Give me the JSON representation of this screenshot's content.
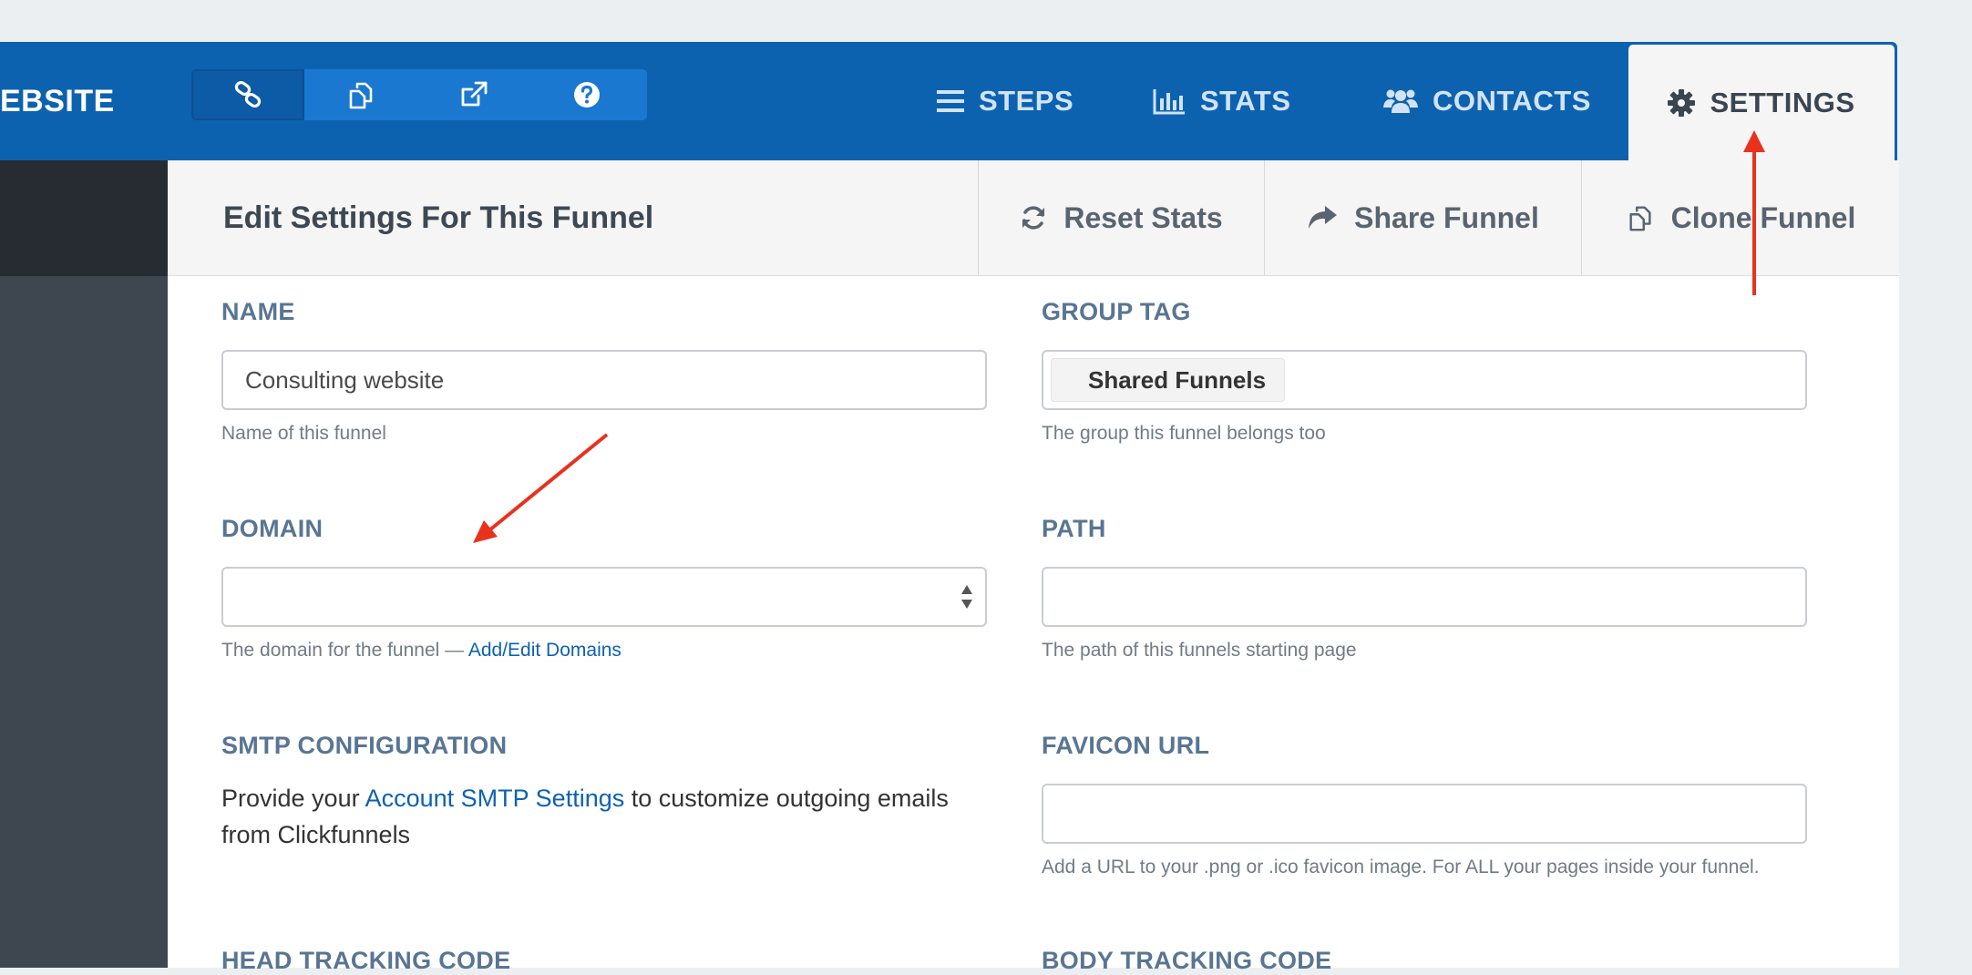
{
  "header": {
    "funnel_name_truncated": "EBSITE",
    "nav": {
      "steps": "STEPS",
      "stats": "STATS",
      "contacts": "CONTACTS",
      "settings": "SETTINGS"
    },
    "icon_buttons": [
      "link-icon",
      "copy-icon",
      "external-link-icon",
      "help-icon"
    ]
  },
  "subheader": {
    "title": "Edit Settings For This Funnel",
    "actions": {
      "reset": "Reset Stats",
      "share": "Share Funnel",
      "clone": "Clone Funnel"
    }
  },
  "form": {
    "name": {
      "label": "NAME",
      "value": "Consulting website",
      "help": "Name of this funnel"
    },
    "group_tag": {
      "label": "GROUP TAG",
      "tag": "Shared Funnels",
      "help": "The group this funnel belongs too"
    },
    "domain": {
      "label": "DOMAIN",
      "value": "",
      "help_prefix": "The domain for the funnel — ",
      "help_link": "Add/Edit Domains"
    },
    "path": {
      "label": "PATH",
      "value": "",
      "help": "The path of this funnels starting page"
    },
    "smtp": {
      "label": "SMTP CONFIGURATION",
      "text_before": "Provide your ",
      "link": "Account SMTP Settings",
      "text_after": " to customize outgoing emails from Clickfunnels"
    },
    "favicon": {
      "label": "FAVICON URL",
      "value": "",
      "help": "Add a URL to your .png or .ico favicon image. For ALL your pages inside your funnel."
    },
    "head_tracking": {
      "label": "HEAD TRACKING CODE"
    },
    "body_tracking": {
      "label": "BODY TRACKING CODE"
    }
  },
  "colors": {
    "brand_blue": "#0d62b0",
    "annotation_arrow": "#e8321e",
    "label_blue": "#587593"
  }
}
